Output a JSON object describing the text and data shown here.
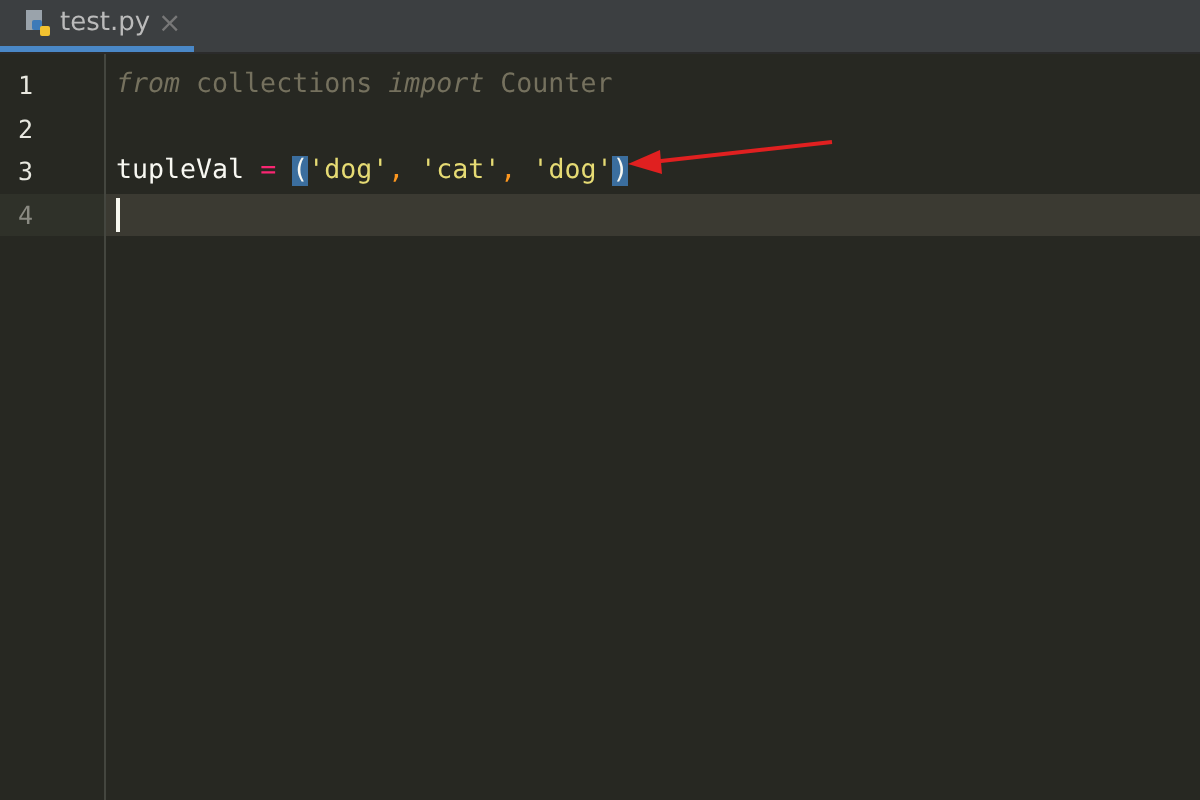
{
  "tabs": [
    {
      "label": "test.py",
      "selected": true,
      "close": "×"
    }
  ],
  "editor": {
    "lines": [
      {
        "number": "1",
        "current": false,
        "tokens": [
          {
            "kind": "keyword",
            "text": "from"
          },
          {
            "kind": "unused",
            "text": " collections "
          },
          {
            "kind": "keyword",
            "text": "import"
          },
          {
            "kind": "unused",
            "text": " Counter"
          }
        ]
      },
      {
        "number": "2",
        "current": false
      },
      {
        "number": "3",
        "current": false,
        "tokens": [
          {
            "kind": "name",
            "text": "tupleVal "
          },
          {
            "kind": "operator",
            "text": "= "
          },
          {
            "kind": "brace",
            "text": "("
          },
          {
            "kind": "string",
            "text": "'dog'"
          },
          {
            "kind": "comma",
            "text": ", "
          },
          {
            "kind": "string",
            "text": "'cat'"
          },
          {
            "kind": "comma",
            "text": ", "
          },
          {
            "kind": "string",
            "text": "'dog'"
          },
          {
            "kind": "brace",
            "text": ")"
          }
        ]
      },
      {
        "number": "4",
        "current": true
      }
    ]
  }
}
